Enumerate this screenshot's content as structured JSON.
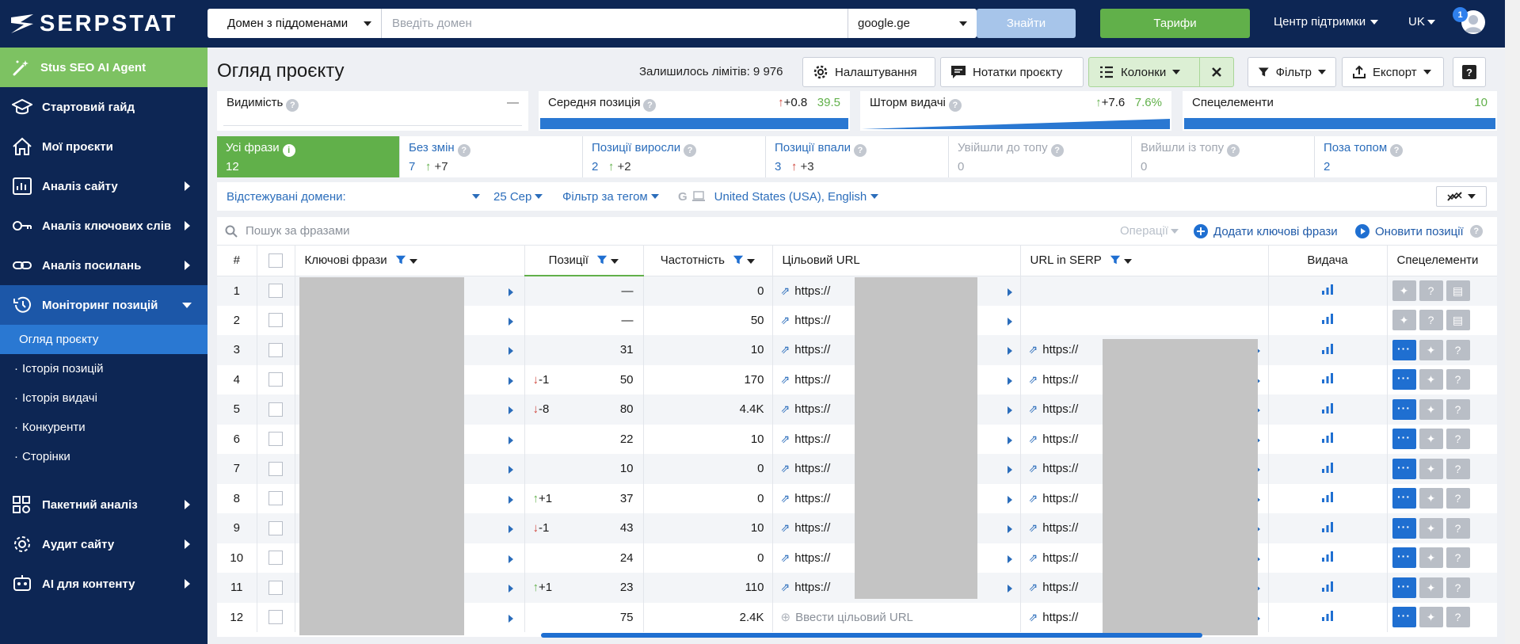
{
  "header": {
    "logo_text": "SERPSTAT",
    "domain_mode": "Домен з піддоменами",
    "domain_placeholder": "Введіть домен",
    "search_engine": "google.ge",
    "find_label": "Знайти",
    "tariffs_label": "Тарифи",
    "support_label": "Центр підтримки",
    "language": "UK",
    "notifications": "1"
  },
  "sidebar": {
    "ai_agent": "Stus SEO AI Agent",
    "items": [
      {
        "label": "Стартовий гайд"
      },
      {
        "label": "Мої проєкти"
      },
      {
        "label": "Аналіз сайту"
      },
      {
        "label": "Аналіз ключових слів"
      },
      {
        "label": "Аналіз посилань"
      },
      {
        "label": "Моніторинг позицій"
      }
    ],
    "subitems": [
      {
        "label": "Огляд проєкту"
      },
      {
        "label": "Історія позицій"
      },
      {
        "label": "Історія видачі"
      },
      {
        "label": "Конкуренти"
      },
      {
        "label": "Сторінки"
      }
    ],
    "bottom_items": [
      {
        "label": "Пакетний аналіз"
      },
      {
        "label": "Аудит сайту"
      },
      {
        "label": "AI для контенту"
      }
    ]
  },
  "toolbar": {
    "page_title": "Огляд проєкту",
    "limits": "Залишилось лімітів: 9 976",
    "settings": "Налаштування",
    "notes": "Нотатки проєкту",
    "columns": "Колонки",
    "filter": "Фільтр",
    "export": "Експорт",
    "help": "?"
  },
  "cards": [
    {
      "label": "Видимість",
      "change": "",
      "value": "—"
    },
    {
      "label": "Середня позиція",
      "change": "+0.8",
      "value": "39.5"
    },
    {
      "label": "Шторм видачі",
      "change": "+7.6",
      "value": "7.6%"
    },
    {
      "label": "Спецелементи",
      "change": "",
      "value": "10"
    }
  ],
  "tabs": [
    {
      "label": "Усі фрази",
      "count": "12",
      "delta": ""
    },
    {
      "label": "Без змін",
      "count": "7",
      "delta": "+7"
    },
    {
      "label": "Позиції виросли",
      "count": "2",
      "delta": "+2"
    },
    {
      "label": "Позиції впали",
      "count": "3",
      "delta": "+3"
    },
    {
      "label": "Увійшли до топу",
      "count": "0",
      "delta": ""
    },
    {
      "label": "Вийшли із топу",
      "count": "0",
      "delta": ""
    },
    {
      "label": "Поза топом",
      "count": "2",
      "delta": ""
    }
  ],
  "filters": {
    "tracked_domains": "Відстежувані домени:",
    "date": "25 Сер",
    "tag_filter": "Фільтр за тегом",
    "region": "United States (USA), English"
  },
  "table": {
    "search_placeholder": "Пошук за фразами",
    "operations": "Операції",
    "add_keywords": "Додати ключові фрази",
    "update_positions": "Оновити позиції",
    "columns": [
      "#",
      "Ключові фрази",
      "Позиції",
      "Частотність",
      "Цільовий URL",
      "URL in SERP",
      "Видача",
      "Спецелементи"
    ],
    "enter_target_url": "Ввести цільовий URL",
    "rows": [
      {
        "n": "1",
        "change": "",
        "dir": "",
        "pos": "—",
        "freq": "0",
        "url": "https://",
        "serp": ""
      },
      {
        "n": "2",
        "change": "",
        "dir": "",
        "pos": "—",
        "freq": "50",
        "url": "https://",
        "serp": ""
      },
      {
        "n": "3",
        "change": "",
        "dir": "",
        "pos": "31",
        "freq": "10",
        "url": "https://",
        "serp": "https://"
      },
      {
        "n": "4",
        "change": "-1",
        "dir": "down",
        "pos": "50",
        "freq": "170",
        "url": "https://",
        "serp": "https://"
      },
      {
        "n": "5",
        "change": "-8",
        "dir": "down",
        "pos": "80",
        "freq": "4.4K",
        "url": "https://",
        "serp": "https://"
      },
      {
        "n": "6",
        "change": "",
        "dir": "",
        "pos": "22",
        "freq": "10",
        "url": "https://",
        "serp": "https://"
      },
      {
        "n": "7",
        "change": "",
        "dir": "",
        "pos": "10",
        "freq": "0",
        "url": "https://",
        "serp": "https://"
      },
      {
        "n": "8",
        "change": "+1",
        "dir": "up",
        "pos": "37",
        "freq": "0",
        "url": "https://",
        "serp": "https://"
      },
      {
        "n": "9",
        "change": "-1",
        "dir": "down",
        "pos": "43",
        "freq": "10",
        "url": "https://",
        "serp": "https://"
      },
      {
        "n": "10",
        "change": "",
        "dir": "",
        "pos": "24",
        "freq": "0",
        "url": "https://",
        "serp": "https://"
      },
      {
        "n": "11",
        "change": "+1",
        "dir": "up",
        "pos": "23",
        "freq": "110",
        "url": "https://",
        "serp": "https://"
      },
      {
        "n": "12",
        "change": "",
        "dir": "",
        "pos": "75",
        "freq": "2.4K",
        "url": "",
        "serp": "https://"
      }
    ]
  }
}
